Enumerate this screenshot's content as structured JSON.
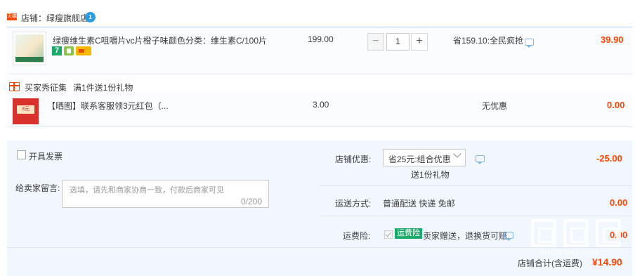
{
  "shop": {
    "badge": "天猫",
    "name": "店铺：绿瘦旗舰店",
    "chat_badge": "1"
  },
  "items": [
    {
      "title": "绿瘦维生素C咀嚼片vc片橙子味...",
      "sku": "颜色分类：维生素C/100片",
      "price": "199.00",
      "quantity": "1",
      "promo": "省159.10:全民疯抢",
      "total": "39.90",
      "service_icons": [
        "7",
        "gift-icon",
        "card-icon"
      ]
    },
    {
      "title": "【晒图】联系客服领3元红包（...",
      "price": "3.00",
      "promo": "无优惠",
      "total": "0.00",
      "thumb_tag": "3元"
    }
  ],
  "gift_group": {
    "label": "买家秀征集",
    "rule": "满1件送1份礼物"
  },
  "invoice": {
    "label": "开具发票"
  },
  "message": {
    "label": "给卖家留言:",
    "placeholder": "选填，请先和商家协商一致，付款后商家可见",
    "count": "0/200"
  },
  "shop_discount": {
    "label": "店铺优惠:",
    "selected": "省25元:组合优惠",
    "sub": "送1份礼物",
    "value": "-25.00"
  },
  "shipping": {
    "label": "运送方式:",
    "method": "普通配送 快递 免邮",
    "fee": "0.00"
  },
  "insurance": {
    "label": "运费险:",
    "badge": "运费险",
    "text": "卖家赠送，退换货可赔",
    "fee": "0.00"
  },
  "summary": {
    "label": "店铺合计(含运费)",
    "value": "¥14.90"
  },
  "watermark": {
    "text": "ZHIDEMAI.COM"
  },
  "colors": {
    "accent": "#ff4400",
    "panel": "#f2f7ff",
    "green": "#1aa86b"
  }
}
